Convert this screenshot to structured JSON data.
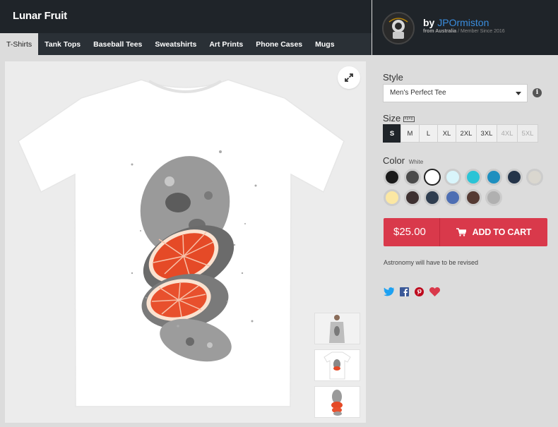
{
  "product": {
    "title": "Lunar Fruit",
    "description": "Astronomy will have to be revised"
  },
  "tabs": [
    {
      "label": "T-Shirts",
      "active": true
    },
    {
      "label": "Tank Tops"
    },
    {
      "label": "Baseball Tees"
    },
    {
      "label": "Sweatshirts"
    },
    {
      "label": "Art Prints"
    },
    {
      "label": "Phone Cases"
    },
    {
      "label": "Mugs"
    }
  ],
  "artist": {
    "by_label": "by",
    "name": "JPOrmiston",
    "location_label": "from Australia",
    "member_since": "Member Since 2016"
  },
  "style": {
    "label": "Style",
    "selected": "Men's Perfect Tee"
  },
  "size": {
    "label": "Size",
    "options": [
      {
        "label": "S",
        "selected": true
      },
      {
        "label": "M"
      },
      {
        "label": "L"
      },
      {
        "label": "XL"
      },
      {
        "label": "2XL"
      },
      {
        "label": "3XL"
      },
      {
        "label": "4XL",
        "disabled": true
      },
      {
        "label": "5XL",
        "disabled": true
      }
    ]
  },
  "color": {
    "label": "Color",
    "selected_name": "White",
    "swatches": [
      "#1a1a1a",
      "#4a4a4a",
      "#ffffff",
      "#d9f5fb",
      "#2bc4d6",
      "#1e8fbf",
      "#243449",
      "#dad7cf",
      "#fbe7a3",
      "#3d3030",
      "#2f3d4f",
      "#4d6eb3",
      "#553a33",
      "#b0b0b0"
    ]
  },
  "cart": {
    "price": "$25.00",
    "label": "ADD TO CART",
    "color": "#d9394b"
  },
  "icons": [
    "twitter-icon",
    "facebook-icon",
    "pinterest-icon",
    "heart-icon"
  ]
}
